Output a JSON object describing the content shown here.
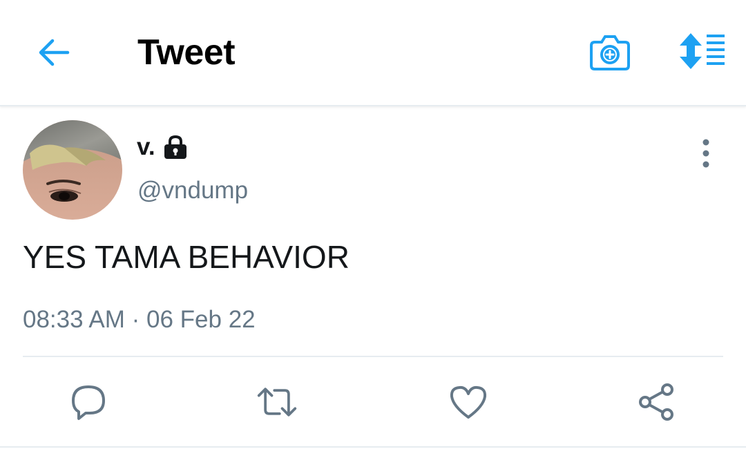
{
  "header": {
    "title": "Tweet"
  },
  "tweet": {
    "author": {
      "display_name": "v.",
      "handle": "@vndump",
      "protected": true
    },
    "text": "YES TAMA BEHAVIOR",
    "time": "08:33 AM",
    "separator": "·",
    "date": "06 Feb 22"
  },
  "icons": {
    "back": "arrow-left-icon",
    "camera": "camera-plus-icon",
    "sort": "sort-order-icon",
    "lock": "lock-icon",
    "more": "more-vertical-icon",
    "reply": "reply-icon",
    "retweet": "retweet-icon",
    "like": "heart-icon",
    "share": "share-icon"
  },
  "colors": {
    "accent": "#1da1f2",
    "text_primary": "#14171a",
    "text_secondary": "#657786",
    "divider": "#e6ecf0"
  }
}
